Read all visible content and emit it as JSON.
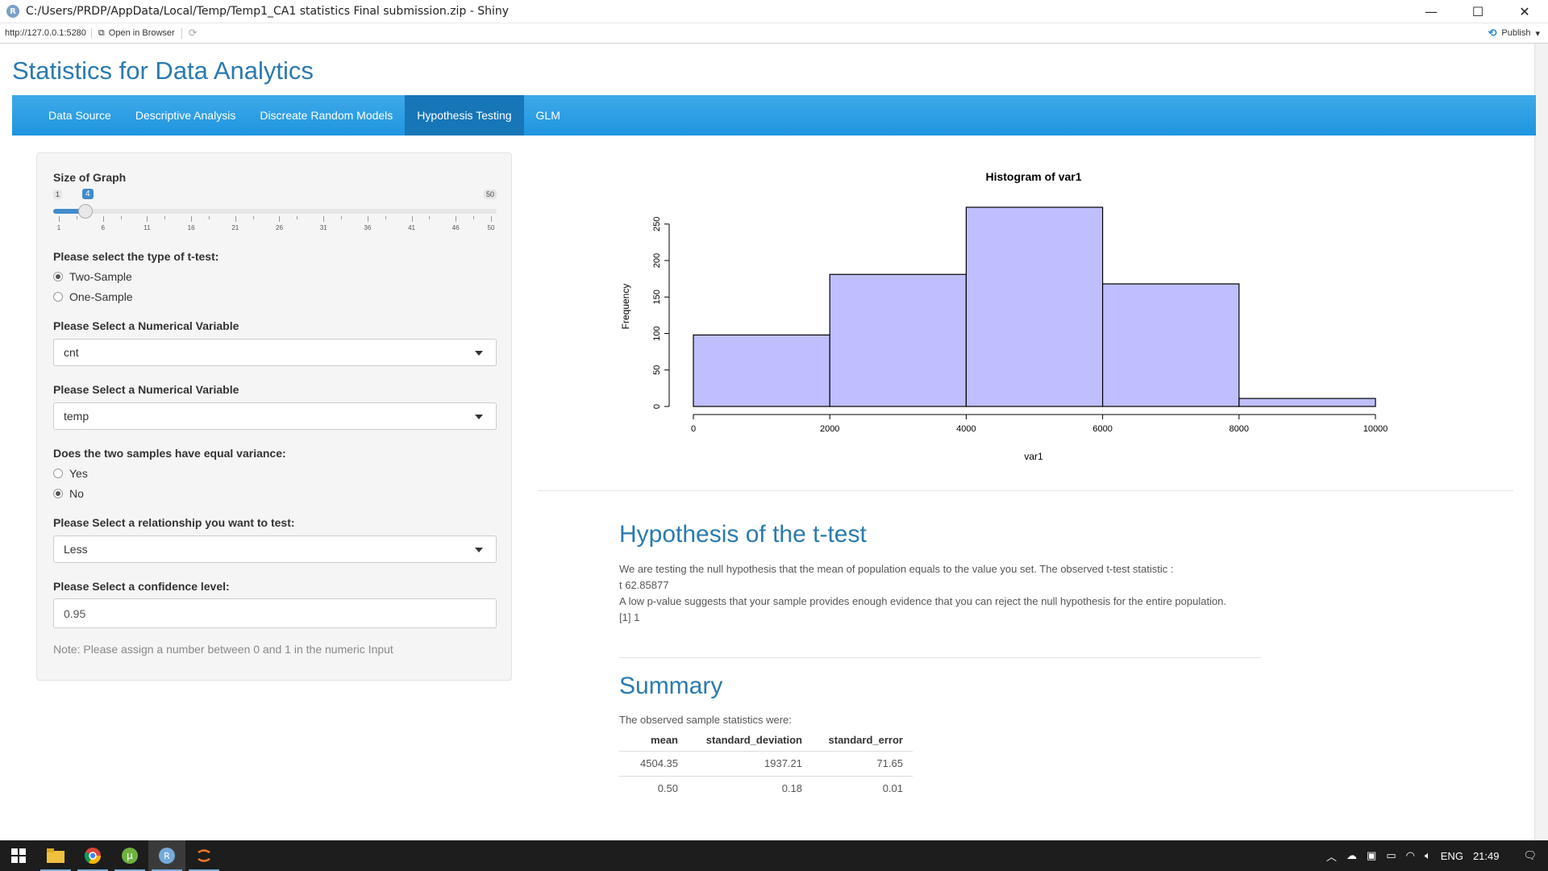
{
  "window": {
    "title": "C:/Users/PRDP/AppData/Local/Temp/Temp1_CA1 statistics Final submission.zip - Shiny",
    "minimize": "—",
    "maximize": "☐",
    "close": "✕"
  },
  "toolbar": {
    "url": "http://127.0.0.1:5280",
    "open_in_browser": "Open in Browser",
    "publish": "Publish"
  },
  "app": {
    "title": "Statistics for Data Analytics",
    "tabs": [
      {
        "label": "Data Source",
        "active": false
      },
      {
        "label": "Descriptive Analysis",
        "active": false
      },
      {
        "label": "Discreate Random Models",
        "active": false
      },
      {
        "label": "Hypothesis Testing",
        "active": true
      },
      {
        "label": "GLM",
        "active": false
      }
    ]
  },
  "sidebar": {
    "size_label": "Size of Graph",
    "slider": {
      "min": "1",
      "max": "50",
      "value": "4",
      "ticks": [
        "1",
        "6",
        "11",
        "16",
        "21",
        "26",
        "31",
        "36",
        "41",
        "46",
        "50"
      ]
    },
    "ttest_label": "Please select the type of t-test:",
    "ttest_options": [
      {
        "label": "Two-Sample",
        "selected": true
      },
      {
        "label": "One-Sample",
        "selected": false
      }
    ],
    "var1_label": "Please Select a Numerical Variable",
    "var1_value": "cnt",
    "var2_label": "Please Select a Numerical Variable",
    "var2_value": "temp",
    "variance_label": "Does the two samples have equal variance:",
    "variance_options": [
      {
        "label": "Yes",
        "selected": false
      },
      {
        "label": "No",
        "selected": true
      }
    ],
    "relationship_label": "Please Select a relationship you want to test:",
    "relationship_value": "Less",
    "confidence_label": "Please Select a confidence level:",
    "confidence_value": "0.95",
    "note": "Note: Please assign a number between 0 and 1 in the numeric Input"
  },
  "chart_data": {
    "type": "bar",
    "title": "Histogram of var1",
    "xlabel": "var1",
    "ylabel": "Frequency",
    "bins": [
      [
        0,
        2000
      ],
      [
        2000,
        4000
      ],
      [
        4000,
        6000
      ],
      [
        6000,
        8000
      ],
      [
        8000,
        10000
      ]
    ],
    "values": [
      98,
      181,
      273,
      168,
      11
    ],
    "xticks": [
      "0",
      "2000",
      "4000",
      "6000",
      "8000",
      "10000"
    ],
    "yticks": [
      "0",
      "50",
      "100",
      "150",
      "200",
      "250"
    ],
    "xlim": [
      0,
      10000
    ],
    "ylim": [
      0,
      273
    ],
    "bar_color": "#bfbfff"
  },
  "hypothesis": {
    "heading": "Hypothesis of the t-test",
    "line1": "We are testing the null hypothesis that the mean of population equals to the value you set. The observed t-test statistic :",
    "line2": "t 62.85877",
    "line3": "A low p-value suggests that your sample provides enough evidence that you can reject the null hypothesis for the entire population.",
    "line4": "[1] 1"
  },
  "summary": {
    "heading": "Summary",
    "intro": "The observed sample statistics were:",
    "columns": [
      "mean",
      "standard_deviation",
      "standard_error"
    ],
    "rows": [
      [
        "4504.35",
        "1937.21",
        "71.65"
      ],
      [
        "0.50",
        "0.18",
        "0.01"
      ]
    ]
  },
  "taskbar": {
    "language": "ENG",
    "time": "21:49"
  }
}
